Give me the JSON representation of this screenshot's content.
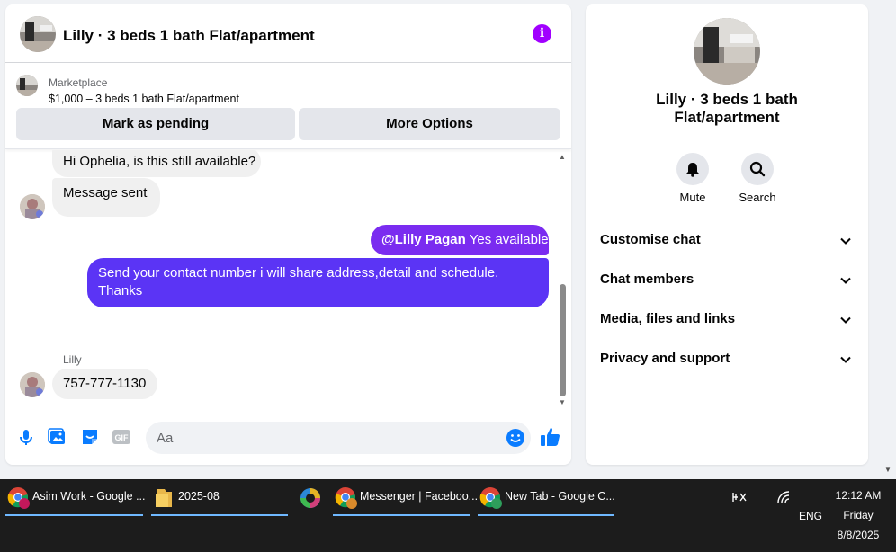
{
  "chat": {
    "title": "Lilly · 3 beds 1 bath Flat/apartment",
    "info_icon": "info-icon",
    "listing": {
      "source": "Marketplace",
      "price_title": "$1,000 – 3 beds 1 bath Flat/apartment",
      "mark_pending_label": "Mark as pending",
      "more_options_label": "More Options"
    },
    "messages": [
      {
        "direction": "in",
        "text": "Hi Ophelia, is this still available?"
      },
      {
        "direction": "in",
        "text": "Message sent"
      },
      {
        "direction": "out",
        "mention": "@Lilly Pagan",
        "text": "Yes available"
      },
      {
        "direction": "out",
        "text": "Send your contact number i will share address,detail and schedule. Thanks"
      },
      {
        "direction": "in",
        "sender": "Lilly",
        "text": "757-777-1130"
      }
    ],
    "composer": {
      "placeholder": "Aa",
      "gif_label": "GIF"
    }
  },
  "info_panel": {
    "name": "Lilly · 3 beds 1 bath Flat/apartment",
    "actions": [
      {
        "label": "Mute",
        "icon": "bell-icon"
      },
      {
        "label": "Search",
        "icon": "search-icon"
      }
    ],
    "sections": [
      {
        "label": "Customise chat"
      },
      {
        "label": "Chat members"
      },
      {
        "label": "Media, files and links"
      },
      {
        "label": "Privacy and support"
      }
    ]
  },
  "taskbar": {
    "items": [
      {
        "label": "Asim Work - Google ...",
        "icon": "chrome-icon"
      },
      {
        "label": "2025-08",
        "icon": "folder-icon"
      },
      {
        "label": "Messenger | Faceboo...",
        "icon": "chrome-icon"
      },
      {
        "label": "New Tab - Google C...",
        "icon": "chrome-icon"
      }
    ],
    "tray": {
      "language": "ENG",
      "time": "12:12 AM",
      "day": "Friday",
      "date": "8/8/2025"
    }
  },
  "colors": {
    "accent": "#a100ff",
    "outgoing_bubble_1": "#7a2cf0",
    "outgoing_bubble_2": "#5b34f5",
    "composer_icons": "#0a7cff",
    "taskbar": "#1c1c1c"
  }
}
